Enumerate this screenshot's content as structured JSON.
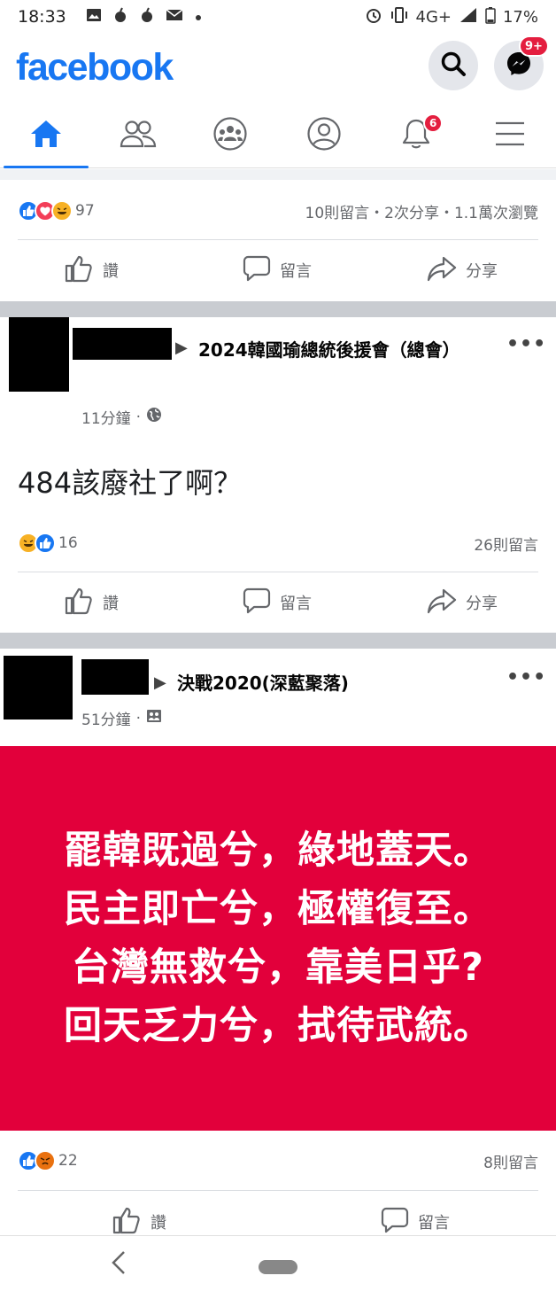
{
  "status_bar": {
    "time": "18:33",
    "network": "4G+",
    "battery": "17%",
    "left_icons": [
      "gallery-icon",
      "fruit-icon",
      "fruit-icon",
      "mail-icon",
      "dot-icon"
    ],
    "right_icons": [
      "alarm-icon",
      "vibrate-icon",
      "signal-icon",
      "battery-icon"
    ]
  },
  "header": {
    "logo": "facebook",
    "messenger_badge": "9+"
  },
  "tabs": {
    "items": [
      "home",
      "friends",
      "groups",
      "profile",
      "notifications",
      "menu"
    ],
    "active": "home",
    "notifications_badge": "6"
  },
  "post_prev": {
    "reaction_count": "97",
    "stats": "10則留言・2次分享・1.1萬次瀏覽",
    "actions": {
      "like": "讚",
      "comment": "留言",
      "share": "分享"
    }
  },
  "post1": {
    "arrow": "▶",
    "group": "2024韓國瑜總統後援會（總會）",
    "time": "11分鐘",
    "audience_icon": "globe-icon",
    "text": "484該廢社了啊？",
    "reaction_count": "16",
    "comments": "26則留言",
    "actions": {
      "like": "讚",
      "comment": "留言",
      "share": "分享"
    }
  },
  "post2": {
    "arrow": "▶",
    "group": "決戰2020(深藍聚落)",
    "time": "51分鐘",
    "audience_icon": "group-icon",
    "image_lines": [
      "罷韓既過兮，綠地蓋天。",
      "民主即亡兮，極權復至。",
      "台灣無救兮，靠美日乎?",
      "回天乏力兮，拭待武統。"
    ],
    "image_color": "#e2003b",
    "reaction_count": "22",
    "comments": "8則留言",
    "actions": {
      "like": "讚",
      "comment": "留言"
    }
  },
  "nav": {
    "back_icon": "back-chevron-icon",
    "home_icon": "home-pill-icon"
  },
  "colors": {
    "brand": "#1877f2",
    "badge": "#e41e3f",
    "text_muted": "#65676b"
  }
}
